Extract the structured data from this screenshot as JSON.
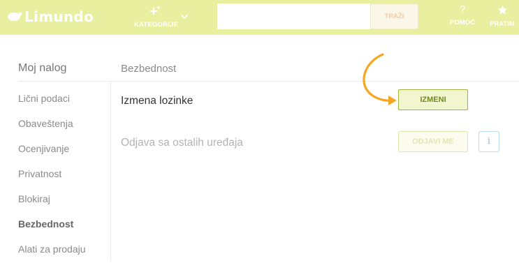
{
  "header": {
    "logo_text": "Limundo",
    "categories_label": "KATEGORIJE",
    "search": {
      "value": "",
      "button_label": "TRAŽI"
    },
    "help_icon": "?",
    "help_label": "POMOĆ",
    "follow_label": "PRATIM"
  },
  "sidebar": {
    "title": "Moj nalog",
    "items": [
      {
        "label": "Lični podaci"
      },
      {
        "label": "Obaveštenja"
      },
      {
        "label": "Ocenjivanje"
      },
      {
        "label": "Privatnost"
      },
      {
        "label": "Blokiraj"
      },
      {
        "label": "Bezbednost",
        "active": true
      },
      {
        "label": "Alati za prodaju"
      }
    ]
  },
  "main": {
    "title": "Bezbednost",
    "rows": [
      {
        "label": "Izmena lozinke",
        "button_label": "IZMENI"
      },
      {
        "label": "Odjava sa ostalih uređaja",
        "button_label": "ODJAVI ME",
        "info_label": "i"
      }
    ]
  },
  "colors": {
    "header_bg": "#e8ef9f",
    "accent_green": "#a0b23e",
    "arrow_orange": "#f5a623",
    "info_blue": "#8bb9dd"
  },
  "icons": [
    "sparkle-icon",
    "chevron-down-icon",
    "question-icon",
    "star-icon",
    "curved-arrow-icon",
    "info-icon"
  ]
}
